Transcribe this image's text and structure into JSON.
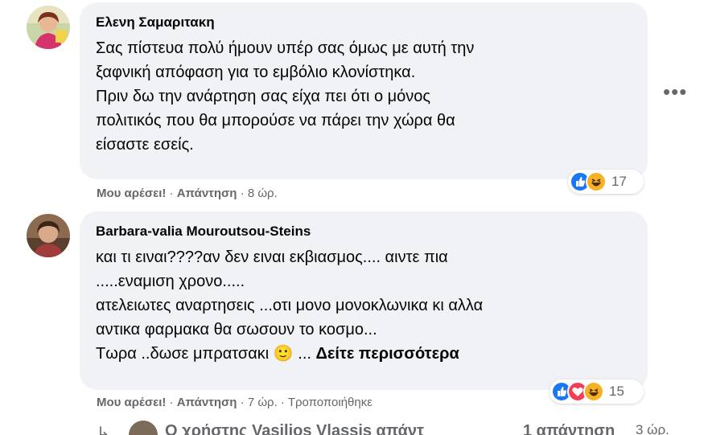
{
  "comments": [
    {
      "author": "Ελενη Σαμαριτακη",
      "lines": [
        "Σας πίστευα πολύ ήμουν υπέρ σας όμως με αυτή την",
        "ξαφνική απόφαση για το εμβόλιο κλονίστηκα.",
        "Πριν δω την ανάρτηση σας είχα πει ότι ο μόνος",
        "πολιτικός που θα μπορούσε να πάρει την χώρα θα",
        "είσαστε εσείς."
      ],
      "like_label": "Μου αρέσει!",
      "reply_label": "Απάντηση",
      "time": "8 ώρ.",
      "reaction_count": "17",
      "reactions": [
        "like-icon",
        "haha-icon"
      ],
      "more_icon": "more-options-icon"
    },
    {
      "author": "Barbara-valia Mouroutsou-Steins",
      "lines": [
        "και τι ειναι????αν δεν ειναι εκβιασμος.... αιντε πια",
        ".....εναμιση χρονο.....",
        "ατελειωτες αναρτησεις ...οτι μονο μονοκλωνικα κι αλλα",
        "αντικα φαρμακα θα σωσουν το κοσμο...",
        "Τωρα ..δωσε μπρατσακι"
      ],
      "emoji": "🙂",
      "ellipsis": "...",
      "see_more": "Δείτε περισσότερα",
      "like_label": "Μου αρέσει!",
      "reply_label": "Απάντηση",
      "time": "7 ώρ.",
      "edited": "Τροποποιήθηκε",
      "reaction_count": "15",
      "reactions": [
        "like-icon",
        "love-icon",
        "haha-icon"
      ]
    }
  ],
  "reply_row": {
    "text": "Ο χρήστης Vasilios Vlassis απάντ",
    "count": "1 απάντηση",
    "time": "3 ώρ."
  },
  "colors": {
    "bubble": "#f0f2f5",
    "secondary_text": "#65676b",
    "like": "#1877f2",
    "love": "#f33e58",
    "haha": "#f7b125"
  }
}
